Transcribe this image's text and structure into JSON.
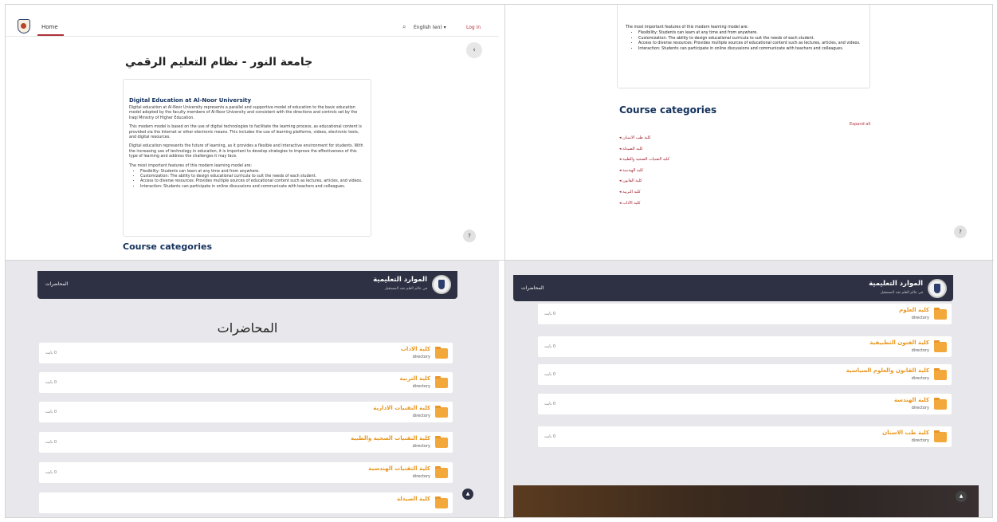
{
  "panel1": {
    "nav": {
      "home": "Home",
      "search_icon": "search-icon",
      "language": "English (en) ▾",
      "login": "Log in"
    },
    "title": "جامعة النور - نظام التعليم الرقمي",
    "card": {
      "heading": "Digital Education at Al-Noor University",
      "paragraphs": [
        "Digital education at Al-Noor University represents a parallel and supportive model of education to the basic education model adopted by the faculty members of Al-Noor University and consistent with the directions and controls set by the Iraqi Ministry of Higher Education.",
        "This modern model is based on the use of digital technologies to facilitate the learning process, as educational content is provided via the Internet or other electronic means. This includes the use of learning platforms, videos, electronic tests, and digital resources.",
        "Digital education represents the future of learning, as it provides a flexible and interactive environment for students. With the increasing use of technology in education, it is important to develop strategies to improve the effectiveness of this type of learning and address the challenges it may face.",
        "The most important features of this modern learning model are:"
      ],
      "features": [
        "Flexibility: Students can learn at any time and from anywhere.",
        "Customization: The ability to design educational curricula to suit the needs of each student.",
        "Access to diverse resources: Provides multiple sources of educational content such as lectures, articles, and videos.",
        "Interaction: Students can participate in online discussions and communicate with teachers and colleagues."
      ]
    },
    "help": "?",
    "course_categories": "Course categories"
  },
  "panel2": {
    "intro": "The most important features of this modern learning model are:",
    "features": [
      "Flexibility: Students can learn at any time and from anywhere.",
      "Customization: The ability to design educational curricula to suit the needs of each student.",
      "Access to diverse resources: Provides multiple sources of educational content such as lectures, articles, and videos.",
      "Interaction: Students can participate in online discussions and communicate with teachers and colleagues."
    ],
    "course_categories": "Course categories",
    "expand_all": "Expand all",
    "categories": [
      "كلية طب الاسنان ◂",
      "كلية الصيدلة ◂",
      "كلية التقنيات الصحية والطبية ◂",
      "كلية الهندسة ◂",
      "كلية القانون ◂",
      "كلية التربية ◂",
      "كلية الآداب ◂"
    ],
    "help": "?"
  },
  "panel3": {
    "brand": "الموارد التعليمية",
    "brand_sub": "في عالم العلم نجد المستقبل",
    "nav": "المحاضرات",
    "heading": "المحاضرات",
    "rows": [
      {
        "name": "كلية الاداب",
        "type": "directory",
        "size": "0 بايت"
      },
      {
        "name": "كلية التربية",
        "type": "directory",
        "size": "0 بايت"
      },
      {
        "name": "كلية التقنيات الادارية",
        "type": "directory",
        "size": "0 بايت"
      },
      {
        "name": "كلية التقنيات الصحية والطبية",
        "type": "directory",
        "size": "0 بايت"
      },
      {
        "name": "كلية التقنيات الهندسية",
        "type": "directory",
        "size": "0 بايت"
      },
      {
        "name": "كلية الصيدلة",
        "type": "directory",
        "size": "0 بايت"
      }
    ],
    "scroll_up": "▲"
  },
  "panel4": {
    "brand": "الموارد التعليمية",
    "brand_sub": "في عالم العلم نجد المستقبل",
    "nav": "المحاضرات",
    "rows": [
      {
        "name": "كلية العلوم",
        "type": "directory",
        "size": "0 بايت"
      },
      {
        "name": "كلية الفنون التطبيقية",
        "type": "directory",
        "size": "0 بايت"
      },
      {
        "name": "كلية القانون والعلوم السياسية",
        "type": "directory",
        "size": "0 بايت"
      },
      {
        "name": "كلية الهندسة",
        "type": "directory",
        "size": "0 بايت"
      },
      {
        "name": "كلية طب الاسنان",
        "type": "directory",
        "size": "0 بايت"
      }
    ],
    "scroll_up": "▲"
  }
}
